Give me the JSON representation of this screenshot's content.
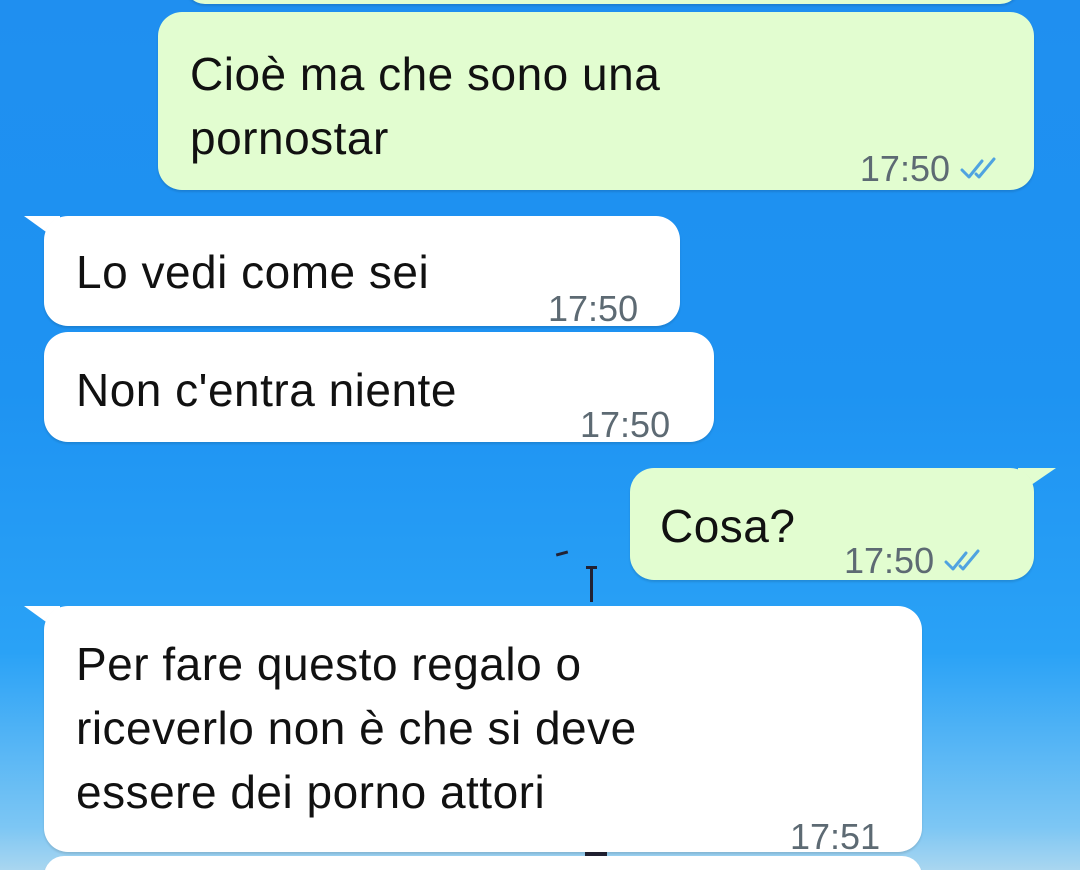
{
  "messages": [
    {
      "direction": "out",
      "text": "Cioè ma che sono una\npornostar",
      "time": "17:50",
      "status": "read"
    },
    {
      "direction": "in",
      "text": "Lo vedi come sei",
      "time": "17:50"
    },
    {
      "direction": "in",
      "text": "Non c'entra niente",
      "time": "17:50"
    },
    {
      "direction": "out",
      "text": "Cosa?",
      "time": "17:50",
      "status": "read"
    },
    {
      "direction": "in",
      "text": "Per fare questo regalo o\nriceverlo non è che si deve\nessere dei porno attori",
      "time": "17:51"
    }
  ],
  "colors": {
    "outgoing_bubble": "#e2fdd0",
    "incoming_bubble": "#ffffff",
    "read_ticks": "#4fa3e0",
    "timestamp": "#5d6a73",
    "wallpaper": "#1f8ff0"
  },
  "icons": {
    "read_receipt": "double-check-icon"
  }
}
